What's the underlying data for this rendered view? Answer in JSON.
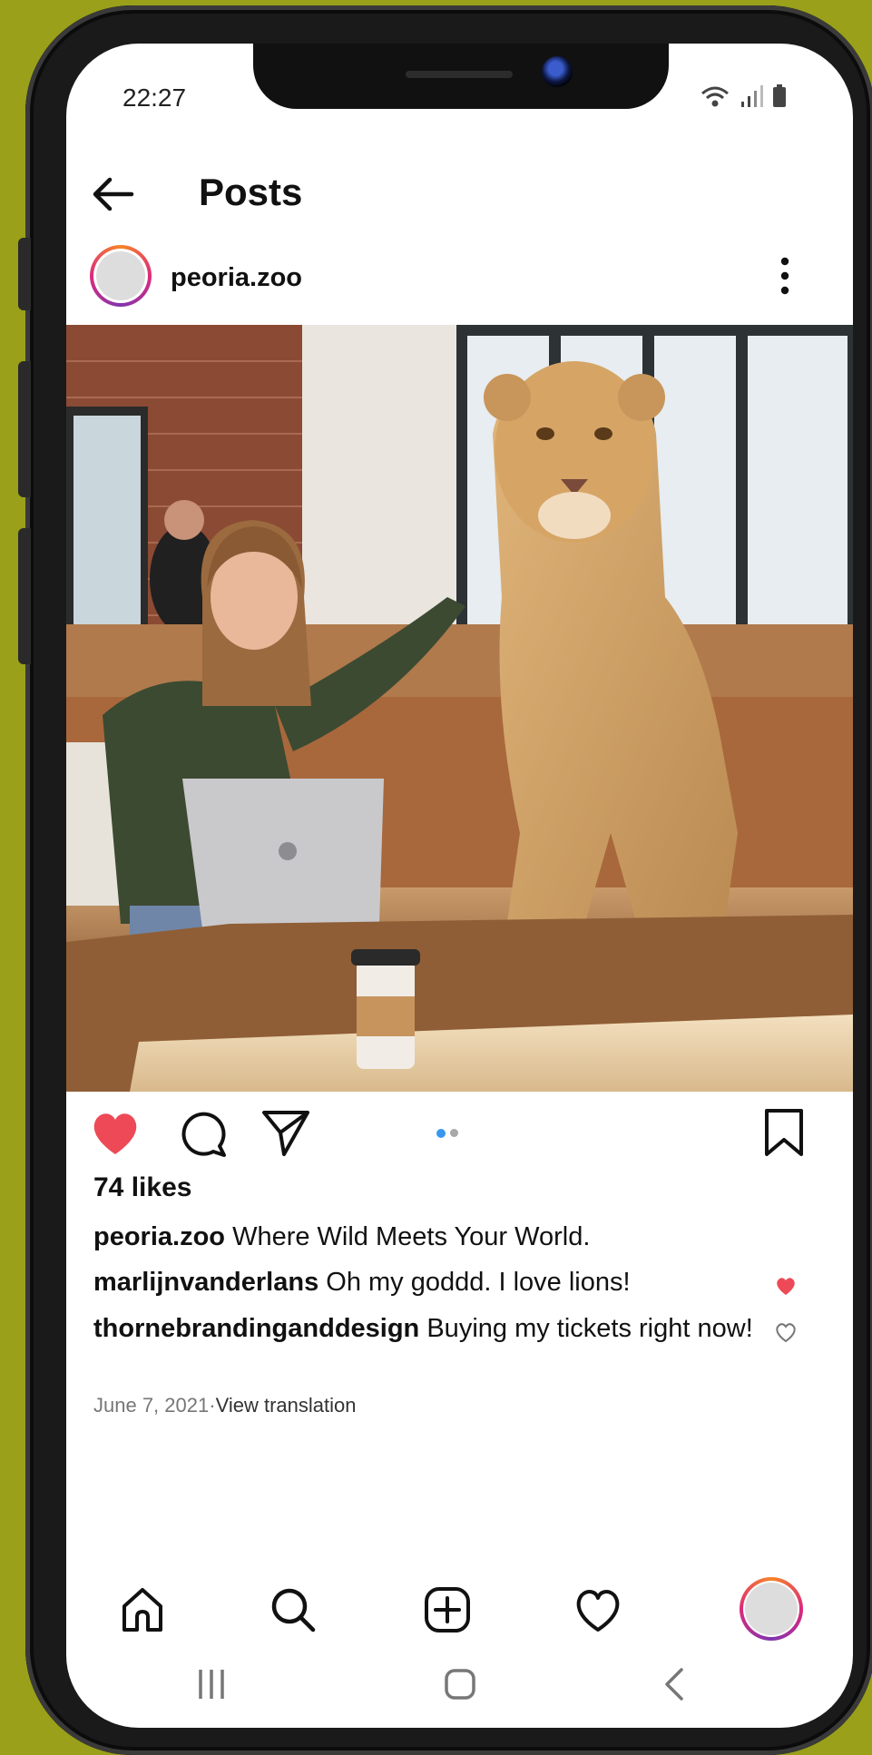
{
  "status_bar": {
    "time": "22:27"
  },
  "header": {
    "title": "Posts"
  },
  "post": {
    "username": "peoria.zoo",
    "likes_count": "74",
    "likes_suffix": "likes",
    "caption": {
      "user": "peoria.zoo",
      "text": "Where Wild Meets Your World."
    },
    "comments": [
      {
        "user": "marlijnvanderlans",
        "text": "Oh my goddd. I love lions!",
        "liked": true
      },
      {
        "user": "thornebrandinganddesign",
        "text": "Buying my tickets right now!",
        "liked": false
      }
    ],
    "date": "June 7, 2021",
    "separator": "·",
    "view_translation": "View translation",
    "carousel": {
      "count": 2,
      "active_index": 0
    },
    "liked": true
  },
  "colors": {
    "like_red": "#ed4956",
    "carousel_active": "#3897f0",
    "carousel_inactive": "#a8a8a8",
    "background": "#9aa01a"
  },
  "icons": {
    "header": [
      "back-arrow-icon"
    ],
    "actions": [
      "heart-icon",
      "comment-icon",
      "share-icon",
      "bookmark-icon"
    ],
    "bottom_nav": [
      "home-icon",
      "search-icon",
      "add-post-icon",
      "activity-heart-icon",
      "profile-avatar"
    ],
    "system_nav": [
      "recent-apps-icon",
      "home-button-icon",
      "back-button-icon"
    ]
  }
}
